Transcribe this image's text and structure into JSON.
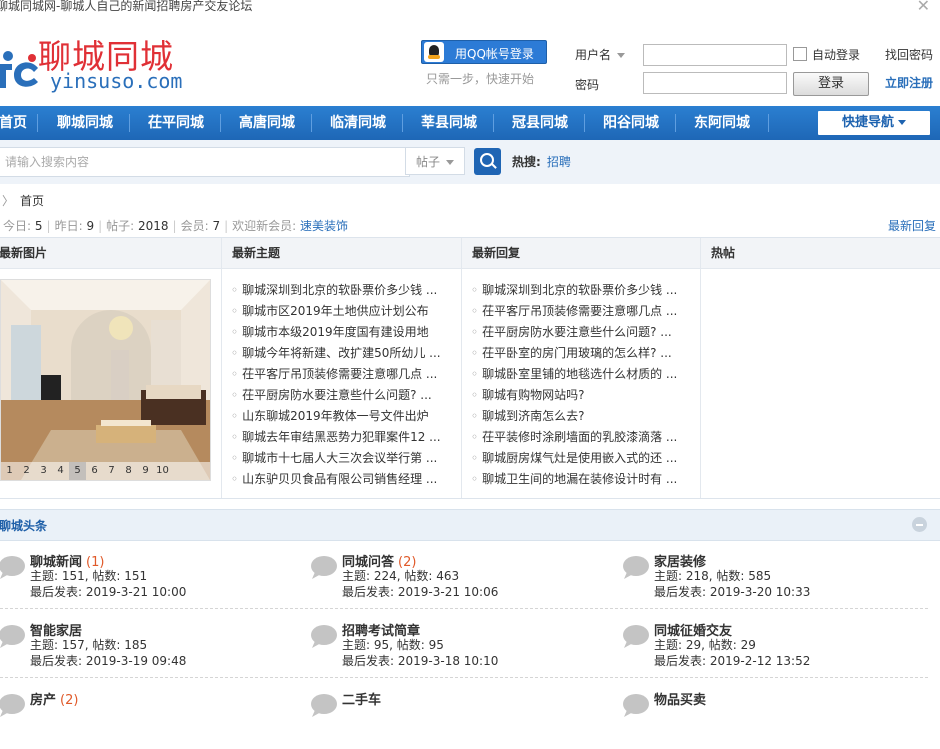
{
  "window": {
    "title": "聊城同城网-聊城人自己的新闻招聘房产交友论坛"
  },
  "header": {
    "logo_title": "聊城同城",
    "logo_sub": "yinsuso.com",
    "qq_login": "用QQ帐号登录",
    "qq_tip": "只需一步，快速开始",
    "username_label": "用户名",
    "password_label": "密码",
    "remember_label": "自动登录",
    "login_button": "登录",
    "find_password": "找回密码",
    "register": "立即注册"
  },
  "nav": {
    "items": [
      "首页",
      "聊城同城",
      "茌平同城",
      "高唐同城",
      "临清同城",
      "莘县同城",
      "冠县同城",
      "阳谷同城",
      "东阿同城"
    ],
    "quick": "快捷导航"
  },
  "search": {
    "placeholder": "请输入搜索内容",
    "type": "帖子",
    "hot_label": "热搜:",
    "hot_terms": [
      "招聘"
    ]
  },
  "breadcrumb": {
    "current": "首页"
  },
  "stats": {
    "today_label": "今日:",
    "today": "5",
    "yesterday_label": "昨日:",
    "yesterday": "9",
    "posts_label": "帖子:",
    "posts": "2018",
    "members_label": "会员:",
    "members": "7",
    "welcome_label": "欢迎新会员:",
    "new_member": "速美装饰",
    "latest_reply": "最新回复"
  },
  "portal": {
    "columns": [
      "最新图片",
      "最新主题",
      "最新回复",
      "热帖"
    ],
    "slider_pages": [
      "1",
      "2",
      "3",
      "4",
      "5",
      "6",
      "7",
      "8",
      "9",
      "10"
    ],
    "slider_current": 5,
    "new_topics": [
      "聊城深圳到北京的软卧票价多少钱 ...",
      "聊城市区2019年土地供应计划公布",
      "聊城市本级2019年度国有建设用地",
      "聊城今年将新建、改扩建50所幼儿 ...",
      "茌平客厅吊顶装修需要注意哪几点 ...",
      "茌平厨房防水要注意些什么问题? ...",
      "山东聊城2019年教体一号文件出炉",
      "聊城去年审结黑恶势力犯罪案件12 ...",
      "聊城市十七届人大三次会议举行第 ...",
      "山东驴贝贝食品有限公司销售经理 ..."
    ],
    "new_replies": [
      "聊城深圳到北京的软卧票价多少钱 ...",
      "茌平客厅吊顶装修需要注意哪几点 ...",
      "茌平厨房防水要注意些什么问题? ...",
      "茌平卧室的房门用玻璃的怎么样? ...",
      "聊城卧室里铺的地毯选什么材质的 ...",
      "聊城有购物网站吗?",
      "聊城到济南怎么去?",
      "茌平装修时涂刷墙面的乳胶漆滴落 ...",
      "聊城厨房煤气灶是使用嵌入式的还 ...",
      "聊城卫生间的地漏在装修设计时有 ..."
    ]
  },
  "category": {
    "title": "聊城头条",
    "forums": [
      {
        "name": "聊城新闻",
        "count": "(1)",
        "meta": "主题: 151, 帖数: 151",
        "last": "最后发表: 2019-3-21 10:00"
      },
      {
        "name": "同城问答",
        "count": "(2)",
        "meta": "主题: 224, 帖数: 463",
        "last": "最后发表: 2019-3-21 10:06"
      },
      {
        "name": "家居装修",
        "count": "",
        "meta": "主题: 218, 帖数: 585",
        "last": "最后发表: 2019-3-20 10:33"
      },
      {
        "name": "智能家居",
        "count": "",
        "meta": "主题: 157, 帖数: 185",
        "last": "最后发表: 2019-3-19 09:48"
      },
      {
        "name": "招聘考试简章",
        "count": "",
        "meta": "主题: 95, 帖数: 95",
        "last": "最后发表: 2019-3-18 10:10"
      },
      {
        "name": "同城征婚交友",
        "count": "",
        "meta": "主题: 29, 帖数: 29",
        "last": "最后发表: 2019-2-12 13:52"
      },
      {
        "name": "房产",
        "count": "(2)",
        "meta": "",
        "last": ""
      },
      {
        "name": "二手车",
        "count": "",
        "meta": "",
        "last": ""
      },
      {
        "name": "物品买卖",
        "count": "",
        "meta": "",
        "last": ""
      }
    ]
  },
  "colors": {
    "nav_blue": "#2b7fd1",
    "link_blue": "#2a6fba",
    "logo_red": "#e03036",
    "count_orange": "#e05a2a"
  }
}
